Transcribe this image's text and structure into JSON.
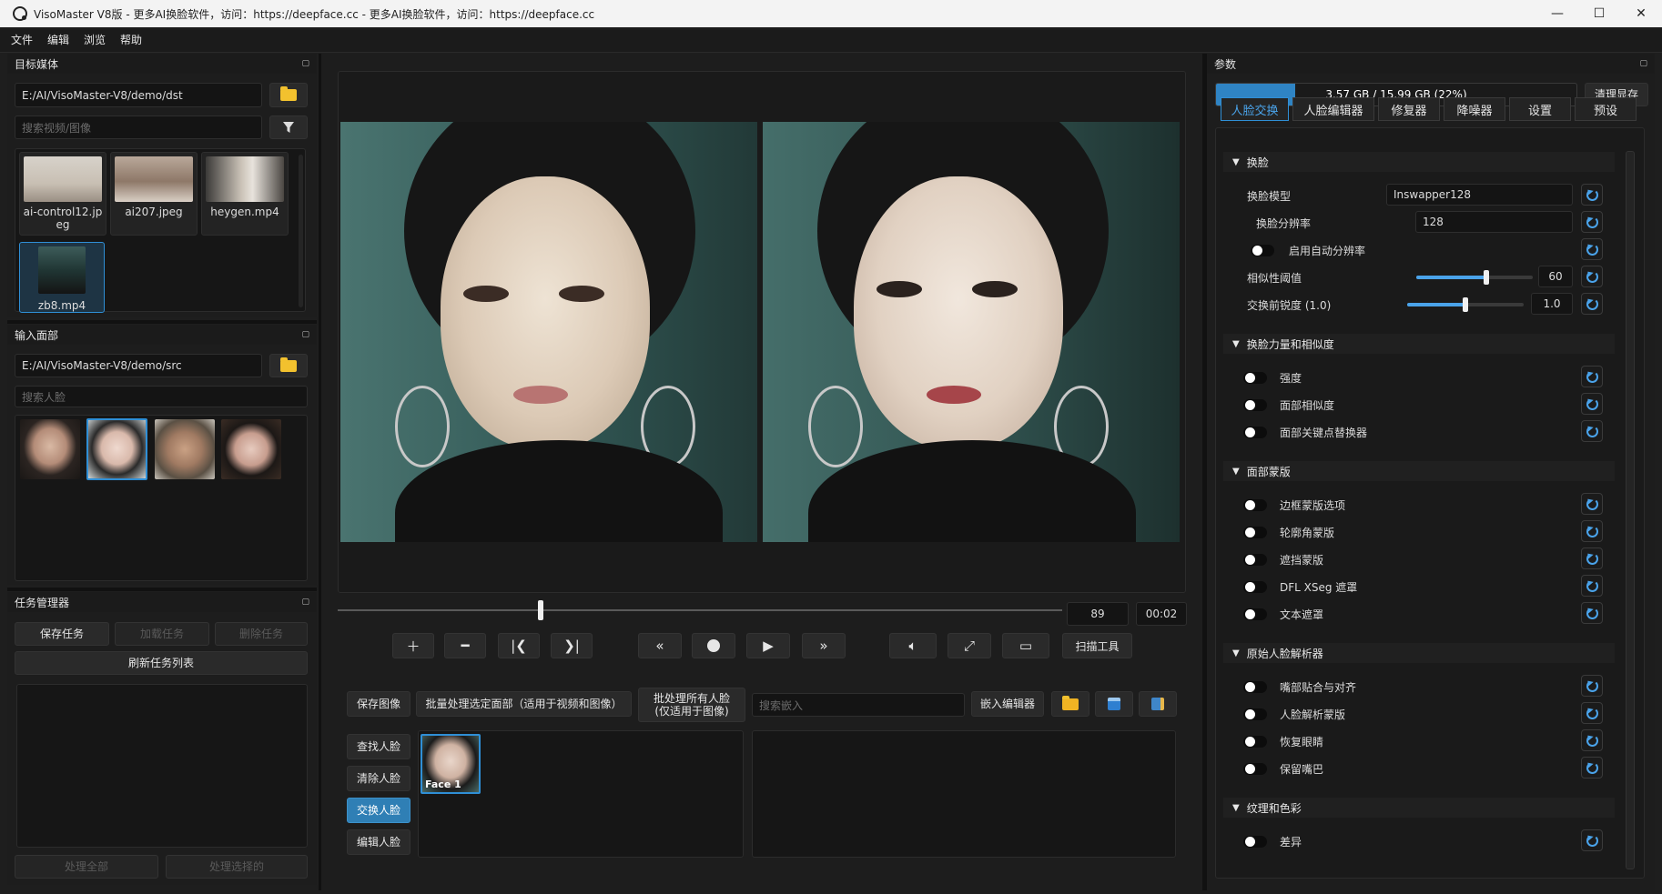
{
  "window": {
    "title": "VisoMaster V8版 - 更多AI换脸软件，访问：https://deepface.cc - 更多AI换脸软件，访问：https://deepface.cc",
    "min": "—",
    "max": "☐",
    "close": "✕"
  },
  "menu": [
    "文件",
    "编辑",
    "浏览",
    "帮助"
  ],
  "target_media": {
    "header": "目标媒体",
    "path": "E:/AI/VisoMaster-V8/demo/dst",
    "search_placeholder": "搜索视频/图像",
    "items": [
      {
        "name": "ai-control12.jp\neg"
      },
      {
        "name": "ai207.jpeg"
      },
      {
        "name": "heygen.mp4"
      },
      {
        "name": "zb8.mp4"
      }
    ]
  },
  "input_faces": {
    "header": "输入面部",
    "path": "E:/AI/VisoMaster-V8/demo/src",
    "search_placeholder": "搜索人脸"
  },
  "job_manager": {
    "header": "任务管理器",
    "save_job": "保存任务",
    "load_job": "加载任务",
    "delete_job": "删除任务",
    "refresh": "刷新任务列表",
    "process_all": "处理全部",
    "process_selected": "处理选择的"
  },
  "playback": {
    "frame": "89",
    "time": "00:02",
    "scan_tools": "扫描工具",
    "progress": 0.28
  },
  "face_tools": {
    "save_image": "保存图像",
    "batch_selected": "批量处理选定面部（适用于视频和图像）",
    "batch_all_line1": "批处理所有人脸",
    "batch_all_line2": "(仅适用于图像)",
    "search_embed_placeholder": "搜索嵌入",
    "embed_editor": "嵌入编辑器",
    "find_faces": "查找人脸",
    "clear_faces": "清除人脸",
    "swap_faces": "交换人脸",
    "edit_faces": "编辑人脸",
    "face_label": "Face 1"
  },
  "params": {
    "header": "参数",
    "memory": "3.57 GB / 15.99 GB (22%)",
    "memory_fraction": 0.22,
    "clear_memory": "清理显存",
    "tabs": [
      "人脸交换",
      "人脸编辑器",
      "修复器",
      "降噪器",
      "设置",
      "预设"
    ],
    "section_swap": "换脸",
    "swap_model_label": "换脸模型",
    "swap_model_value": "Inswapper128",
    "swap_res_label": "换脸分辨率",
    "swap_res_value": "128",
    "auto_res_label": "启用自动分辨率",
    "similarity_label": "相似性阈值",
    "similarity_value": "60",
    "similarity_fraction": 0.6,
    "sharpness_label": "交换前锐度 (1.0)",
    "sharpness_value": "1.0",
    "sharpness_fraction": 0.5,
    "section_strength": "换脸力量和相似度",
    "strength": "强度",
    "face_similarity": "面部相似度",
    "landmark_swap": "面部关键点替换器",
    "section_mask": "面部蒙版",
    "border_mask": "边框蒙版选项",
    "contour_mask": "轮廓角蒙版",
    "occlusion_mask": "遮挡蒙版",
    "dfl_xseg": "DFL XSeg 遮罩",
    "text_mask": "文本遮罩",
    "section_parser": "原始人脸解析器",
    "mouth_fit": "嘴部贴合与对齐",
    "face_parser_mask": "人脸解析蒙版",
    "restore_eyes": "恢复眼睛",
    "keep_mouth": "保留嘴巴",
    "section_texture": "纹理和色彩",
    "difference": "差异"
  }
}
